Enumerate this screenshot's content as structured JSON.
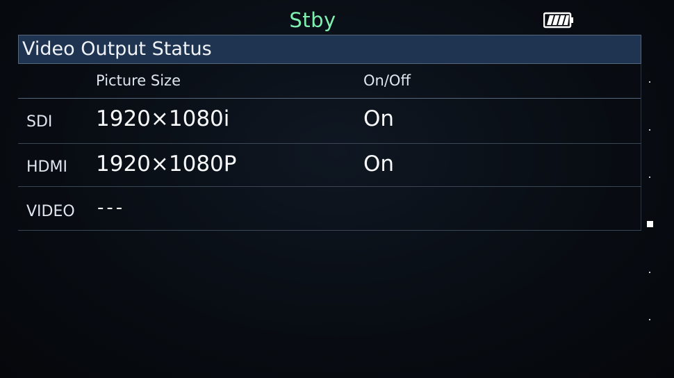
{
  "status": {
    "mode": "Stby"
  },
  "battery": {
    "icon": "battery-full-icon",
    "level": 1.0
  },
  "screen": {
    "title": "Video Output Status"
  },
  "columns": {
    "picture_size": "Picture Size",
    "on_off": "On/Off"
  },
  "rows": [
    {
      "label": "SDI",
      "picture_size": "1920×1080i",
      "on_off": "On"
    },
    {
      "label": "HDMI",
      "picture_size": "1920×1080P",
      "on_off": "On"
    },
    {
      "label": "VIDEO",
      "picture_size": "---",
      "on_off": ""
    }
  ],
  "scrollbar": {
    "pages": 6,
    "current_page": 4
  },
  "colors": {
    "status": "#7ff0b0",
    "header": "#1f3450",
    "background": "#080c12"
  }
}
